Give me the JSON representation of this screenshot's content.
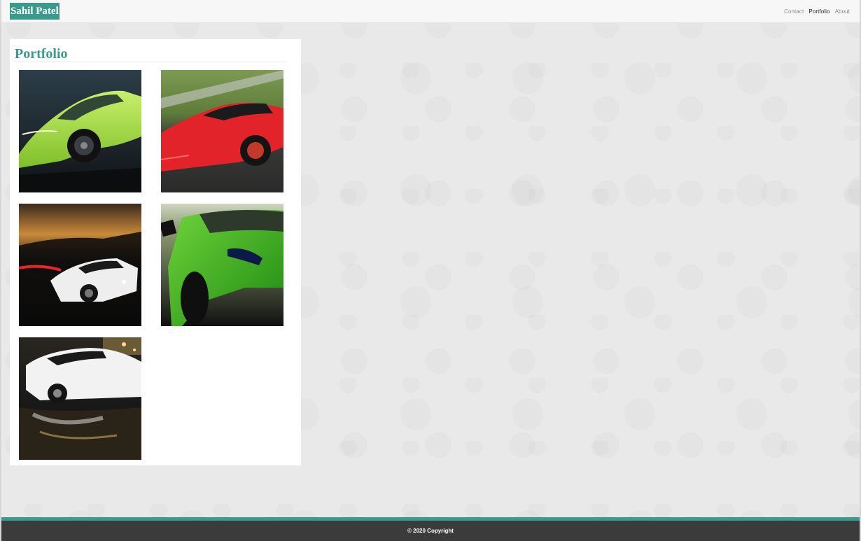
{
  "site": {
    "brand": "Sahil Patel"
  },
  "nav": {
    "items": [
      {
        "label": "Contact",
        "active": false
      },
      {
        "label": "Portfolio",
        "active": true
      },
      {
        "label": "About",
        "active": false
      }
    ]
  },
  "portfolio": {
    "title": "Portfolio",
    "images": [
      {
        "subject": "lime green sports car"
      },
      {
        "subject": "red sports car on track"
      },
      {
        "subject": "white sports car over city lights"
      },
      {
        "subject": "green sports car close-up"
      },
      {
        "subject": "white sports car on wet street"
      }
    ]
  },
  "footer": {
    "text": "© 2020 Copyright"
  },
  "colors": {
    "accent": "#3a9b8d",
    "footer_bg": "#3b3b3b",
    "page_bg": "#e9e9e9"
  }
}
